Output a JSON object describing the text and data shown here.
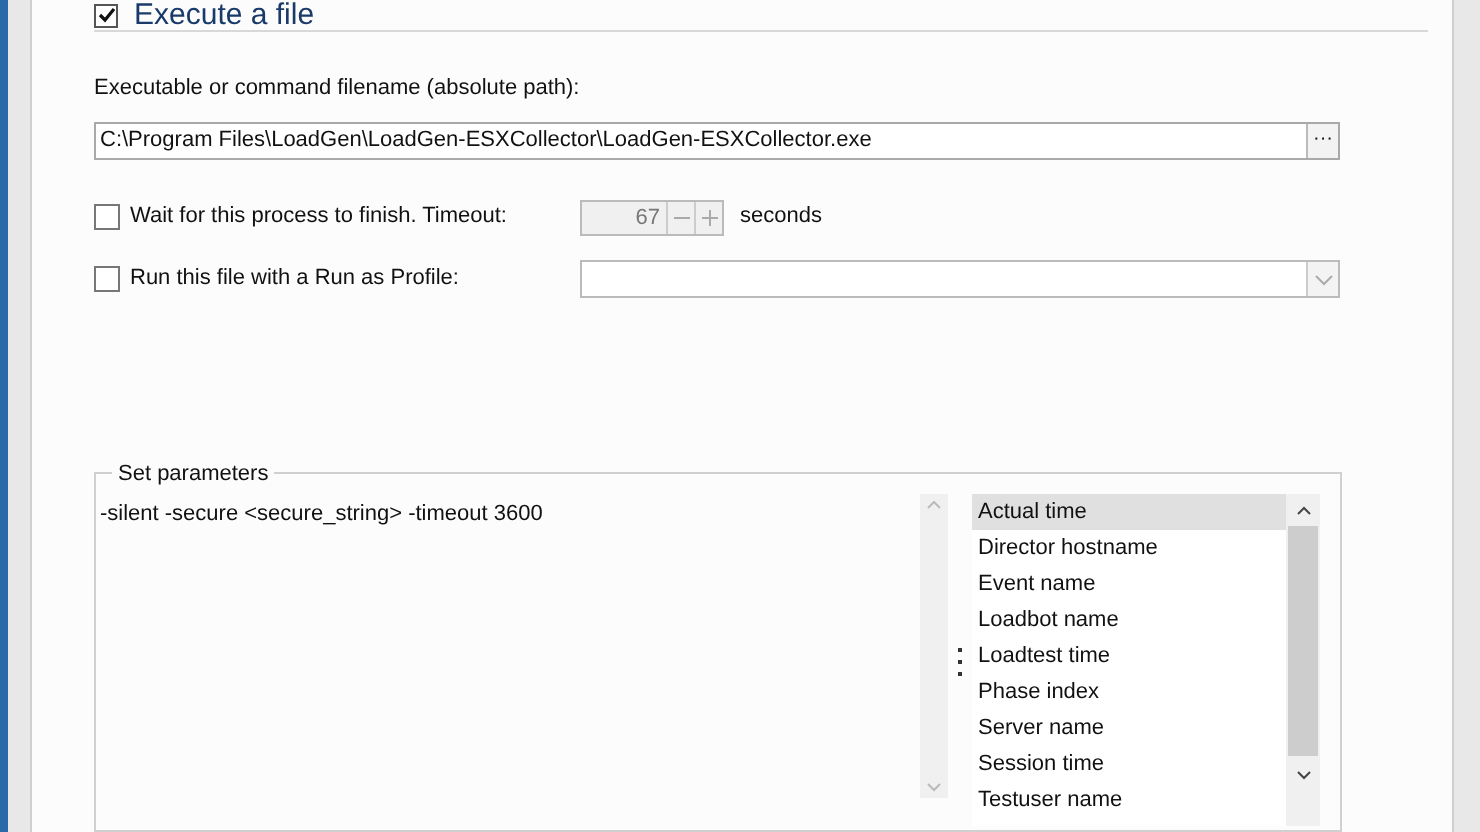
{
  "section": {
    "title": "Execute a file",
    "checked": true
  },
  "filename": {
    "label": "Executable or command filename (absolute path):",
    "value": "C:\\Program Files\\LoadGen\\LoadGen-ESXCollector\\LoadGen-ESXCollector.exe",
    "browse": "···"
  },
  "wait": {
    "label": "Wait for this process to finish.  Timeout:",
    "checked": false,
    "timeout": "67",
    "disabled": true,
    "unit": "seconds"
  },
  "run_as": {
    "label": "Run this file with a Run as Profile:",
    "checked": false
  },
  "parameters": {
    "title": "Set parameters",
    "value": "-silent -secure <secure_string> -timeout 3600",
    "items": [
      {
        "label": "Actual time",
        "selected": true
      },
      {
        "label": "Director hostname",
        "selected": false
      },
      {
        "label": "Event name",
        "selected": false
      },
      {
        "label": "Loadbot name",
        "selected": false
      },
      {
        "label": "Loadtest time",
        "selected": false
      },
      {
        "label": "Phase index",
        "selected": false
      },
      {
        "label": "Server name",
        "selected": false
      },
      {
        "label": "Session time",
        "selected": false
      },
      {
        "label": "Testuser name",
        "selected": false
      }
    ]
  }
}
